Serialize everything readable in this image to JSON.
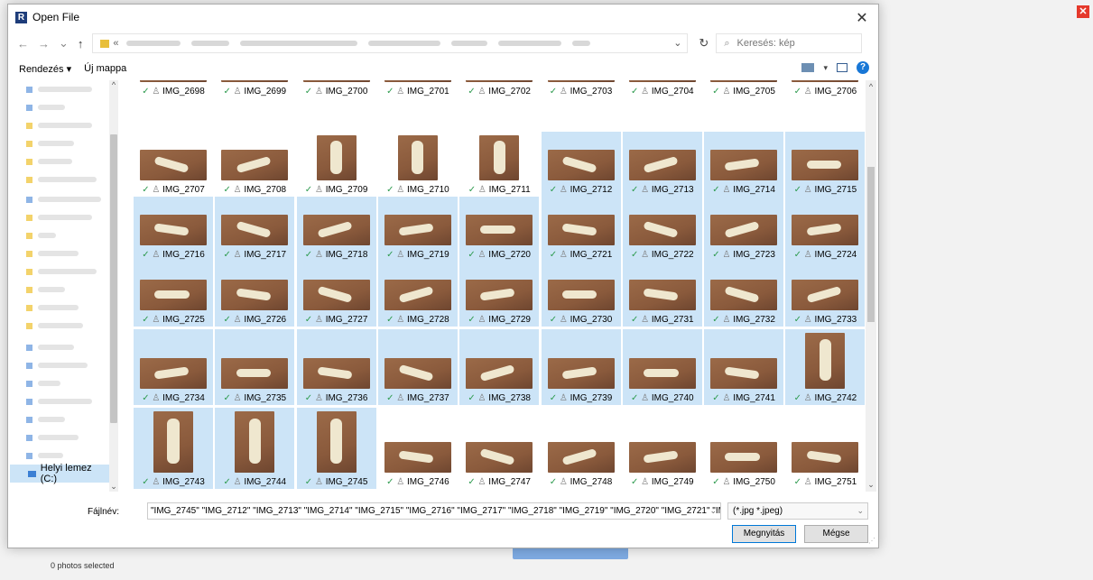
{
  "dialog": {
    "title": "Open File",
    "app_icon_letter": "R",
    "close_glyph": "✕"
  },
  "nav": {
    "back": "←",
    "forward": "→",
    "recent": "⌄",
    "up": "↑",
    "address_prefix": "«",
    "address_chevron": "⌄",
    "refresh": "↻"
  },
  "search": {
    "placeholder": "Keresés: kép",
    "icon": "search-icon"
  },
  "toolbar": {
    "organize": "Rendezés ▾",
    "new_folder": "Új mappa",
    "view_menu": "▾",
    "help": "?"
  },
  "sidebar": {
    "drive_label": "Helyi lemez (C:)"
  },
  "files": {
    "status_check": "✓",
    "status_sync": "♙",
    "rows": [
      [
        {
          "name": "IMG_2698",
          "selected": false
        },
        {
          "name": "IMG_2699",
          "selected": false
        },
        {
          "name": "IMG_2700",
          "selected": false
        },
        {
          "name": "IMG_2701",
          "selected": false
        },
        {
          "name": "IMG_2702",
          "selected": false
        },
        {
          "name": "IMG_2703",
          "selected": false
        },
        {
          "name": "IMG_2704",
          "selected": false
        },
        {
          "name": "IMG_2705",
          "selected": false
        },
        {
          "name": "IMG_2706",
          "selected": false
        }
      ],
      [
        {
          "name": "IMG_2707",
          "selected": false
        },
        {
          "name": "IMG_2708",
          "selected": false
        },
        {
          "name": "IMG_2709",
          "selected": false,
          "portrait": true
        },
        {
          "name": "IMG_2710",
          "selected": false,
          "portrait": true
        },
        {
          "name": "IMG_2711",
          "selected": false,
          "portrait": true
        },
        {
          "name": "IMG_2712",
          "selected": true
        },
        {
          "name": "IMG_2713",
          "selected": true
        },
        {
          "name": "IMG_2714",
          "selected": true
        },
        {
          "name": "IMG_2715",
          "selected": true
        }
      ],
      [
        {
          "name": "IMG_2716",
          "selected": true
        },
        {
          "name": "IMG_2717",
          "selected": true
        },
        {
          "name": "IMG_2718",
          "selected": true
        },
        {
          "name": "IMG_2719",
          "selected": true
        },
        {
          "name": "IMG_2720",
          "selected": true
        },
        {
          "name": "IMG_2721",
          "selected": true
        },
        {
          "name": "IMG_2722",
          "selected": true
        },
        {
          "name": "IMG_2723",
          "selected": true
        },
        {
          "name": "IMG_2724",
          "selected": true
        }
      ],
      [
        {
          "name": "IMG_2725",
          "selected": true
        },
        {
          "name": "IMG_2726",
          "selected": true
        },
        {
          "name": "IMG_2727",
          "selected": true
        },
        {
          "name": "IMG_2728",
          "selected": true
        },
        {
          "name": "IMG_2729",
          "selected": true
        },
        {
          "name": "IMG_2730",
          "selected": true
        },
        {
          "name": "IMG_2731",
          "selected": true
        },
        {
          "name": "IMG_2732",
          "selected": true
        },
        {
          "name": "IMG_2733",
          "selected": true
        }
      ],
      [
        {
          "name": "IMG_2734",
          "selected": true
        },
        {
          "name": "IMG_2735",
          "selected": true
        },
        {
          "name": "IMG_2736",
          "selected": true
        },
        {
          "name": "IMG_2737",
          "selected": true
        },
        {
          "name": "IMG_2738",
          "selected": true
        },
        {
          "name": "IMG_2739",
          "selected": true
        },
        {
          "name": "IMG_2740",
          "selected": true
        },
        {
          "name": "IMG_2741",
          "selected": true
        },
        {
          "name": "IMG_2742",
          "selected": true,
          "portrait": true
        }
      ],
      [
        {
          "name": "IMG_2743",
          "selected": true,
          "portrait": true
        },
        {
          "name": "IMG_2744",
          "selected": true,
          "portrait": true
        },
        {
          "name": "IMG_2745",
          "selected": true,
          "portrait": true
        },
        {
          "name": "IMG_2746",
          "selected": false
        },
        {
          "name": "IMG_2747",
          "selected": false
        },
        {
          "name": "IMG_2748",
          "selected": false
        },
        {
          "name": "IMG_2749",
          "selected": false
        },
        {
          "name": "IMG_2750",
          "selected": false
        },
        {
          "name": "IMG_2751",
          "selected": false
        }
      ]
    ]
  },
  "filename": {
    "label": "Fájlnév:",
    "value": "\"IMG_2745\" \"IMG_2712\" \"IMG_2713\" \"IMG_2714\" \"IMG_2715\" \"IMG_2716\" \"IMG_2717\" \"IMG_2718\" \"IMG_2719\" \"IMG_2720\" \"IMG_2721\" \"IMG_2722\" \"IMG_2",
    "chevron": "⌄"
  },
  "filter": {
    "value": "(*.jpg *.jpeg)",
    "chevron": "⌄"
  },
  "buttons": {
    "open": "Megnyitás",
    "cancel": "Mégse"
  },
  "background": {
    "close_glyph": "✕",
    "status": "0 photos selected"
  },
  "colors": {
    "selection": "#cce4f7",
    "accent": "#0078d7",
    "thumb_bg": "#8a5a3c"
  }
}
